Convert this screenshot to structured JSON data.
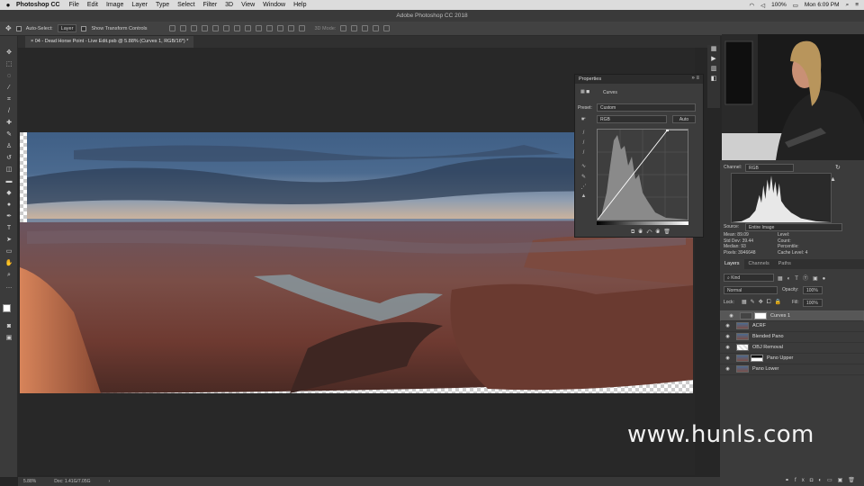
{
  "menubar": {
    "app": "Photoshop CC",
    "items": [
      "File",
      "Edit",
      "Image",
      "Layer",
      "Type",
      "Select",
      "Filter",
      "3D",
      "View",
      "Window",
      "Help"
    ],
    "battery": "100%",
    "clock": "Mon 6:09 PM"
  },
  "window_title": "Adobe Photoshop CC 2018",
  "options": {
    "auto_select_label": "Auto-Select:",
    "auto_select_value": "Layer",
    "show_transform_label": "Show Transform Controls",
    "mode_3d_label": "3D Mode:"
  },
  "document": {
    "tab_title": "04 - Dead Horse Point - Live Edit.psb @ 5.88% (Curves 1, RGB/16*) *"
  },
  "status": {
    "zoom": "5.88%",
    "doc": "Doc: 1.41G/7.05G"
  },
  "properties": {
    "title": "Properties",
    "adjustment_label": "Curves",
    "preset_label": "Preset:",
    "preset_value": "Custom",
    "channel_value": "RGB",
    "auto_label": "Auto"
  },
  "histogram": {
    "channel_label": "Channel:",
    "channel_value": "RGB",
    "source_label": "Source:",
    "source_value": "Entire Image",
    "stats_left": [
      {
        "label": "Mean:",
        "value": "89.09"
      },
      {
        "label": "Std Dev:",
        "value": "39.44"
      },
      {
        "label": "Median:",
        "value": "93"
      },
      {
        "label": "Pixels:",
        "value": "3946648"
      }
    ],
    "stats_right": [
      {
        "label": "Level:",
        "value": ""
      },
      {
        "label": "Count:",
        "value": ""
      },
      {
        "label": "Percentile:",
        "value": ""
      },
      {
        "label": "Cache Level:",
        "value": "4"
      }
    ]
  },
  "layers_panel": {
    "tabs": [
      "Layers",
      "Channels",
      "Paths"
    ],
    "kind_label": "Kind",
    "blend_mode": "Normal",
    "opacity_label": "Opacity:",
    "opacity_value": "100%",
    "lock_label": "Lock:",
    "fill_label": "Fill:",
    "fill_value": "100%",
    "layers": [
      {
        "name": "Curves 1"
      },
      {
        "name": "ACRF"
      },
      {
        "name": "Blended Pano"
      },
      {
        "name": "OBJ Removal"
      },
      {
        "name": "Pano Upper"
      },
      {
        "name": "Pano Lower"
      }
    ]
  },
  "watermark": "www.hunls.com",
  "colors": {
    "ui_dark": "#262626",
    "panel": "#3b3b3b",
    "selected_layer": "#575757",
    "menubar": "#dcdcdc"
  }
}
